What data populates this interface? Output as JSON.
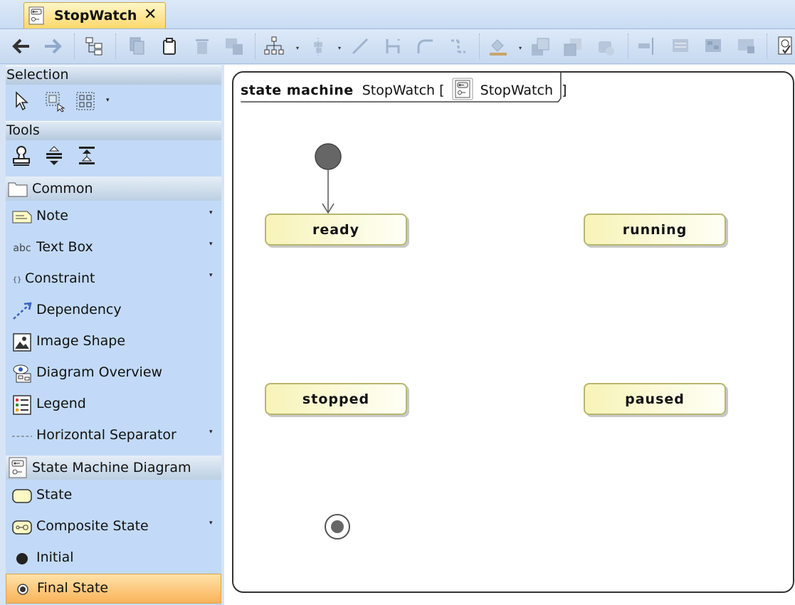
{
  "tab": {
    "title": "StopWatch",
    "close": "✕"
  },
  "toolbar": {
    "buttons": [
      "back-icon",
      "forward-icon",
      "containment-tree-icon",
      "copy-icon",
      "paste-icon",
      "delete-icon",
      "delete-from-model-icon",
      "layout-icon",
      "align-icon",
      "path-style-icon",
      "rectilinear-path-icon",
      "oblique-path-icon",
      "bezier-path-icon",
      "fill-color-icon",
      "send-backward-icon",
      "bring-forward-icon",
      "paint-format-icon",
      "distribute-icon",
      "equal-size-icon",
      "grid-icon",
      "fit-icon",
      "validate-icon"
    ]
  },
  "palette": {
    "selection_header": "Selection",
    "tools_header": "Tools",
    "common_header": "Common",
    "common_items": [
      {
        "label": "Note",
        "icon": "note-icon",
        "dropdown": true
      },
      {
        "label": "Text Box",
        "icon": "text-box-icon",
        "dropdown": true,
        "prefix": "abc"
      },
      {
        "label": "Constraint",
        "icon": "constraint-icon",
        "dropdown": true,
        "prefix": "{}"
      },
      {
        "label": "Dependency",
        "icon": "dependency-icon",
        "dropdown": false
      },
      {
        "label": "Image Shape",
        "icon": "image-icon",
        "dropdown": false
      },
      {
        "label": "Diagram Overview",
        "icon": "diagram-overview-icon",
        "dropdown": false
      },
      {
        "label": "Legend",
        "icon": "legend-icon",
        "dropdown": false
      },
      {
        "label": "Horizontal Separator",
        "icon": "separator-icon",
        "dropdown": true
      }
    ],
    "smd_header": "State Machine Diagram",
    "smd_items": [
      {
        "label": "State",
        "icon": "state-icon",
        "dropdown": false
      },
      {
        "label": "Composite State",
        "icon": "composite-state-icon",
        "dropdown": true
      },
      {
        "label": "Initial",
        "icon": "initial-icon",
        "dropdown": false
      },
      {
        "label": "Final State",
        "icon": "final-state-icon",
        "dropdown": false,
        "selected": true
      }
    ]
  },
  "diagram": {
    "keyword": "state machine",
    "name": "StopWatch [",
    "ref": "StopWatch",
    "close_bracket": "]",
    "states": [
      "ready",
      "running",
      "stopped",
      "paused"
    ]
  },
  "colors": {
    "selected_item": "#f9b35a",
    "palette_bg": "#c2daf7",
    "state_fill": "#f7f3b8"
  }
}
